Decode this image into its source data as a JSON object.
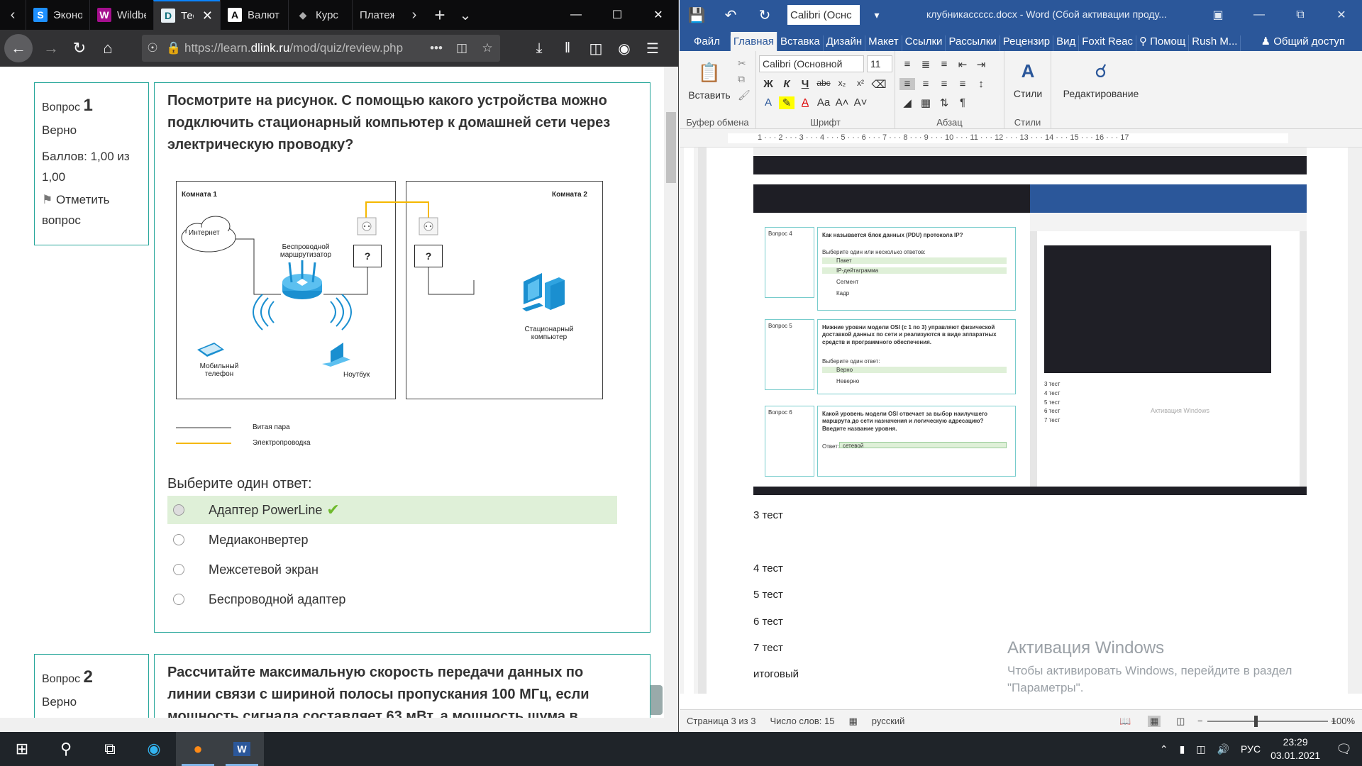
{
  "browser": {
    "tabs": [
      {
        "label": "Эконо",
        "favicon": "S",
        "color": "#1e90ff",
        "fg": "#fff"
      },
      {
        "label": "Wildbe",
        "favicon": "W",
        "color": "#a50f8e",
        "fg": "#fff"
      },
      {
        "label": "Тест",
        "favicon": "D",
        "color": "#e8f0f5",
        "fg": "#0a6d7a"
      },
      {
        "label": "Валют",
        "favicon": "A",
        "color": "#ffffff",
        "fg": "#000"
      },
      {
        "label": "Курс",
        "favicon": "◆",
        "color": "#0c0c0d",
        "fg": "#aaa"
      },
      {
        "label": "Платеж",
        "favicon": "",
        "color": "#0c0c0d",
        "fg": "#fff"
      }
    ],
    "url_prefix": "https://learn.",
    "url_domain": "dlink.ru",
    "url_suffix": "/mod/quiz/review.php",
    "url_more": "•••"
  },
  "quiz": {
    "q1": {
      "label": "Вопрос",
      "number": "1",
      "status": "Верно",
      "score": "Баллов: 1,00 из 1,00",
      "flag": "Отметить вопрос",
      "text": "Посмотрите на рисунок. С помощью какого устройства можно подключить стационарный компьютер к домашней сети через электрическую проводку?",
      "diagram": {
        "room1": "Комната 1",
        "room2": "Комната 2",
        "internet": "Интернет",
        "router": "Беспроводной маршрутизатор",
        "phone": "Мобильный телефон",
        "laptop": "Ноутбук",
        "pc": "Стационарный компьютер",
        "q": "?",
        "legend_twisted": "Витая пара",
        "legend_power": "Электропроводка"
      },
      "choose": "Выберите один ответ:",
      "answers": [
        {
          "text": "Адаптер PowerLine",
          "correct": true
        },
        {
          "text": "Медиаконвертер",
          "correct": false
        },
        {
          "text": "Межсетевой экран",
          "correct": false
        },
        {
          "text": "Беспроводной адаптер",
          "correct": false
        }
      ]
    },
    "q2": {
      "label": "Вопрос",
      "number": "2",
      "status": "Верно",
      "text": "Рассчитайте максимальную скорость передачи данных по линии связи с шириной полосы пропускания 100 МГц, если мощность сигнала составляет 63 мВт, а мощность шума в"
    }
  },
  "word": {
    "font_quick": "Calibri (Оснс",
    "doc_title": "клубникассссс.docx - Word (Сбой активации проду...",
    "menu": [
      "Файл",
      "Главная",
      "Вставка",
      "Дизайн",
      "Макет",
      "Ссылки",
      "Рассылки",
      "Рецензир",
      "Вид",
      "Foxit Reac",
      "Помощ",
      "Rush M..."
    ],
    "share": "Общий доступ",
    "ribbon": {
      "paste": "Вставить",
      "clipboard": "Буфер обмена",
      "font_name": "Calibri (Основной",
      "font_size": "11",
      "font_group": "Шрифт",
      "paragraph": "Абзац",
      "styles": "Стили",
      "styles_group": "Стили",
      "editing": "Редактирование"
    },
    "doc_lines": [
      "3 тест",
      "4 тест",
      "5 тест",
      "6 тест",
      "7 тест",
      "итоговый"
    ],
    "watermark_title": "Активация Windows",
    "watermark_text": "Чтобы активировать Windows, перейдите в раздел \"Параметры\".",
    "embedded": {
      "q4": "Как называется блок данных (PDU) протокола IP?",
      "q4_answers": [
        "Пакет",
        "IP-дейтаграмма",
        "Сегмент",
        "Кадр"
      ],
      "q5": "Нижние уровни модели OSI (с 1 по 3) управляют физической доставкой данных по сети и реализуются в виде аппаратных средств и программного обеспечения.",
      "q5_answers": [
        "Верно",
        "Неверно"
      ],
      "q6": "Какой уровень модели OSI отвечает за выбор наилучшего маршрута до сети назначения и логическую адресацию? Введите название уровня.",
      "q6_answer": "сетевой",
      "answer_label": "Ответ:",
      "choose_many": "Выберите один или несколько ответов:",
      "choose_one": "Выберите один ответ:",
      "vopros": [
        "Вопрос 4",
        "Вопрос 5",
        "Вопрос 6"
      ],
      "right_lines": [
        "3 тест",
        "4 тест",
        "5 тест",
        "6 тест",
        "7 тест"
      ],
      "wm_small": "Активация Windows"
    },
    "status": {
      "page": "Страница 3 из 3",
      "words": "Число слов: 15",
      "lang": "русский",
      "zoom": "100%"
    }
  },
  "taskbar": {
    "lang": "РУС",
    "time": "23:29",
    "date": "03.01.2021"
  }
}
